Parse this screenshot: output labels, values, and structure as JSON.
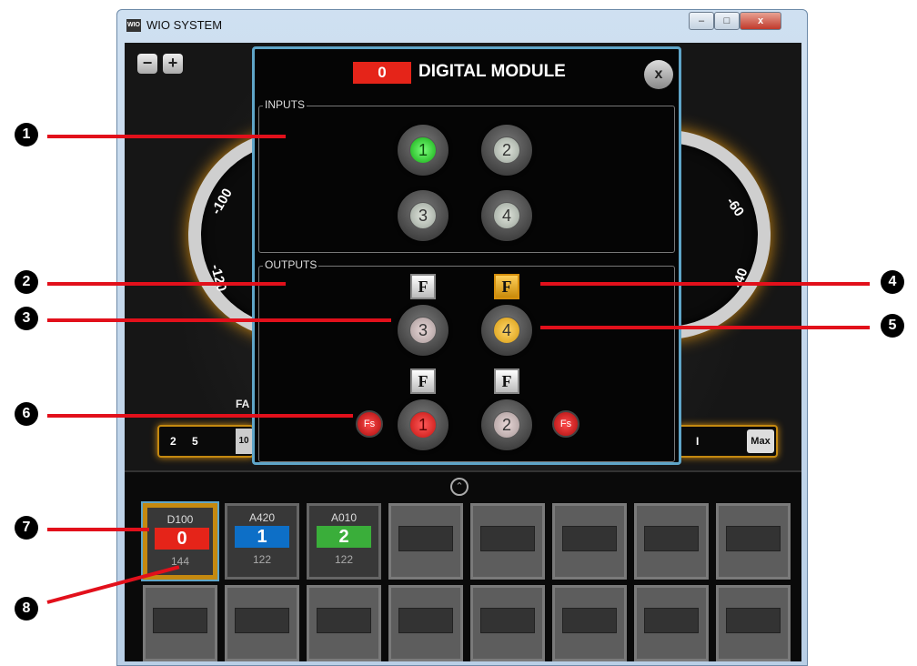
{
  "window": {
    "title": "WIO SYSTEM",
    "logo": "WIO",
    "min": "–",
    "max": "□",
    "close": "x"
  },
  "dashboard": {
    "zoom_out": "−",
    "zoom_in": "+",
    "left_gauge": {
      "label_a": "-100",
      "label_b": "-120"
    },
    "right_gauge": {
      "label_a": "-60",
      "label_b": "-40"
    },
    "fan_label": "FA",
    "left_slider": {
      "a": "2",
      "b": "5",
      "c": "10"
    },
    "right_slider": {
      "a": "I",
      "max": "Max"
    }
  },
  "module": {
    "number": "0",
    "title": "DIGITAL MODULE",
    "close": "x",
    "inputs_label": "INPUTS",
    "outputs_label": "OUTPUTS",
    "inputs": [
      {
        "n": "1",
        "state": "on"
      },
      {
        "n": "2",
        "state": "off"
      },
      {
        "n": "3",
        "state": "off"
      },
      {
        "n": "4",
        "state": "off"
      }
    ],
    "outputs": [
      {
        "n": "3",
        "f": "F"
      },
      {
        "n": "4",
        "f": "F"
      },
      {
        "n": "1",
        "f": "F",
        "fs": "Fs"
      },
      {
        "n": "2",
        "f": "F",
        "fs": "Fs"
      }
    ]
  },
  "devices": [
    {
      "code": "D100",
      "num": "0",
      "count": "144",
      "color": "#e52419"
    },
    {
      "code": "A420",
      "num": "1",
      "count": "122",
      "color": "#0d6fc7"
    },
    {
      "code": "A010",
      "num": "2",
      "count": "122",
      "color": "#3aae3a"
    }
  ],
  "collapse": "⌃",
  "callouts": [
    "1",
    "2",
    "3",
    "4",
    "5",
    "6",
    "7",
    "8"
  ]
}
